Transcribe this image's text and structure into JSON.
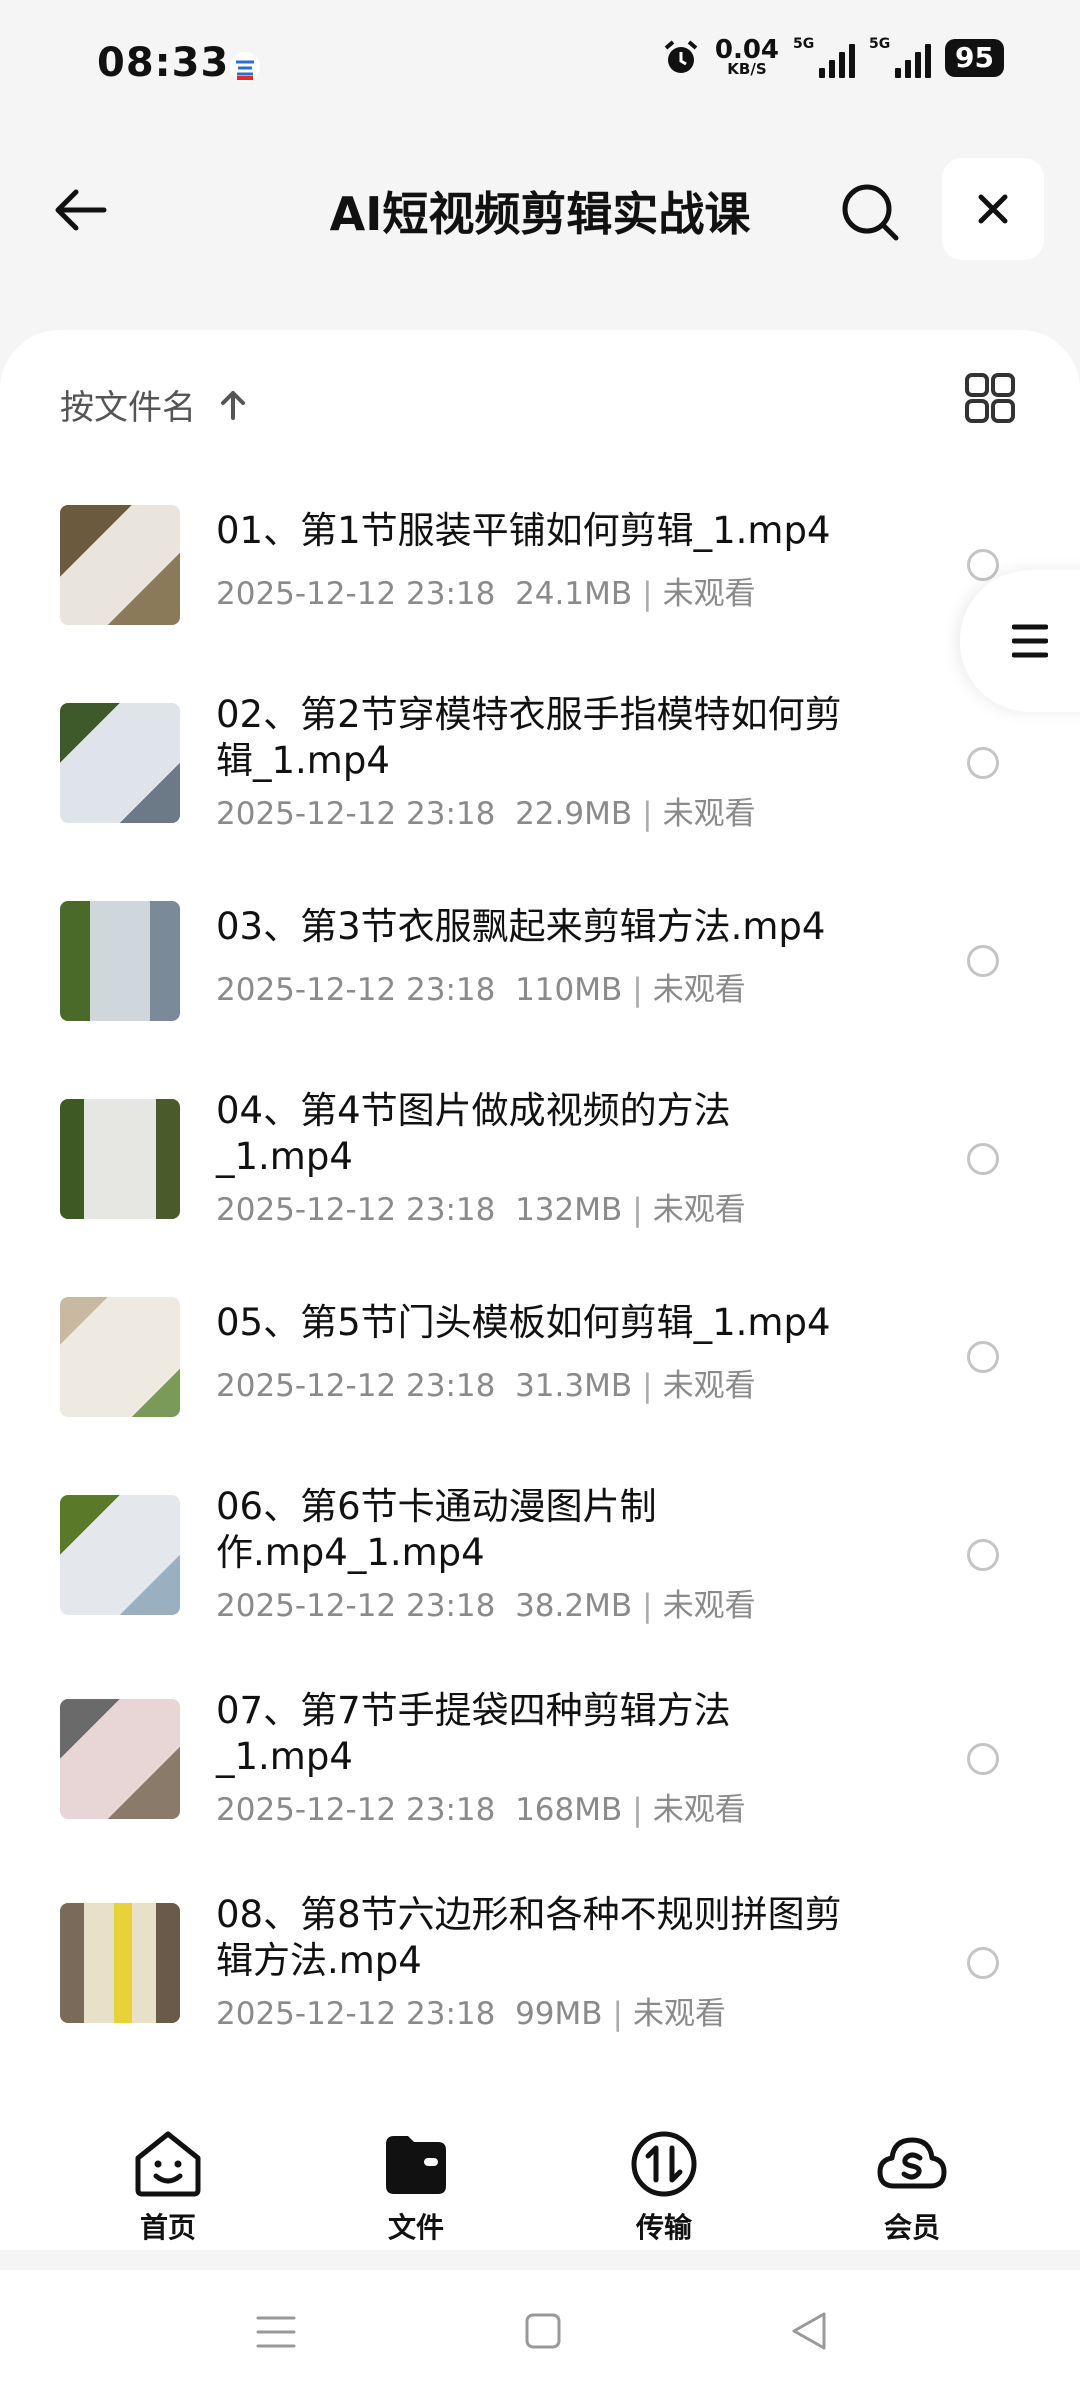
{
  "status": {
    "time": "08:33",
    "speed_value": "0.04",
    "speed_unit": "KB/S",
    "net1": "5G",
    "net2": "5G",
    "battery": "95"
  },
  "header": {
    "title": "AI短视频剪辑实战课"
  },
  "sort": {
    "label": "按文件名"
  },
  "files": [
    {
      "name": "01、第1节服装平铺如何剪辑_1.mp4",
      "date": "2025-12-12 23:18",
      "size": "24.1MB",
      "status": "未观看"
    },
    {
      "name": "02、第2节穿模特衣服手指模特如何剪辑_1.mp4",
      "date": "2025-12-12 23:18",
      "size": "22.9MB",
      "status": "未观看"
    },
    {
      "name": "03、第3节衣服飘起来剪辑方法.mp4",
      "date": "2025-12-12 23:18",
      "size": "110MB",
      "status": "未观看"
    },
    {
      "name": "04、第4节图片做成视频的方法_1.mp4",
      "date": "2025-12-12 23:18",
      "size": "132MB",
      "status": "未观看"
    },
    {
      "name": "05、第5节门头模板如何剪辑_1.mp4",
      "date": "2025-12-12 23:18",
      "size": "31.3MB",
      "status": "未观看"
    },
    {
      "name": "06、第6节卡通动漫图片制作.mp4_1.mp4",
      "date": "2025-12-12 23:18",
      "size": "38.2MB",
      "status": "未观看"
    },
    {
      "name": "07、第7节手提袋四种剪辑方法_1.mp4",
      "date": "2025-12-12 23:18",
      "size": "168MB",
      "status": "未观看"
    },
    {
      "name": "08、第8节六边形和各种不规则拼图剪辑方法.mp4",
      "date": "2025-12-12 23:18",
      "size": "99MB",
      "status": "未观看"
    }
  ],
  "tabs": [
    {
      "label": "首页",
      "icon": "smile-face-icon"
    },
    {
      "label": "文件",
      "icon": "wallet-folder-icon"
    },
    {
      "label": "传输",
      "icon": "transfer-arrows-icon"
    },
    {
      "label": "会员",
      "icon": "cloud-vip-icon"
    }
  ],
  "colors": {
    "sheet": "#ffffff",
    "background": "#f5f5f5",
    "secondary_text": "#8a8a8a"
  }
}
